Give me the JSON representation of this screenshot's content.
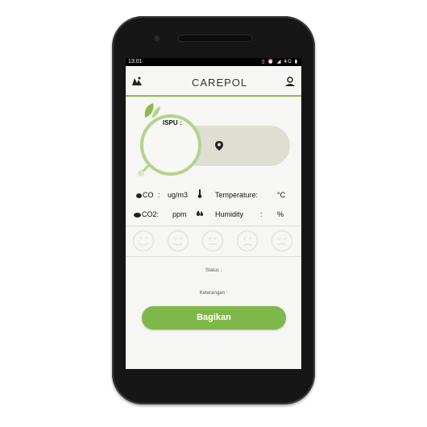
{
  "statusbar": {
    "time": "13:01",
    "network": "4G"
  },
  "app": {
    "title": "CAREPOL"
  },
  "gauge": {
    "ispu_label": "ISPU :"
  },
  "readings": {
    "co_label": "CO",
    "co_value": ":",
    "co_unit": "ug/m3",
    "temp_label": "Temperature:",
    "temp_unit": "°C",
    "co2_label": "CO2:",
    "co2_unit": "ppm",
    "hum_label": "Humidity",
    "hum_value": ":",
    "hum_unit": "%"
  },
  "status": {
    "label": "Status :"
  },
  "keterangan": {
    "label": "Keterangan :"
  },
  "share": {
    "label": "Bagikan"
  },
  "colors": {
    "accent": "#7fb84a",
    "ring": "#b4d38c",
    "pill": "#deded2"
  }
}
